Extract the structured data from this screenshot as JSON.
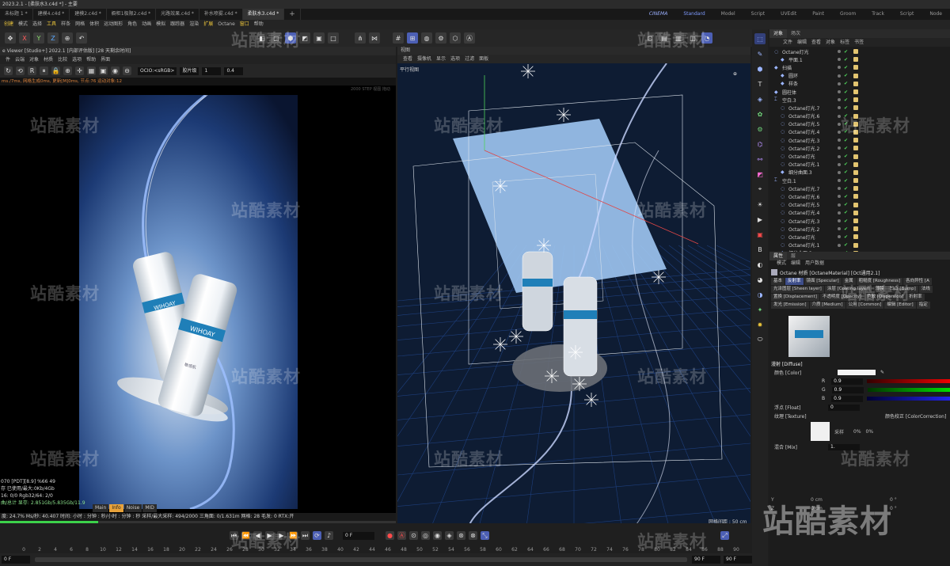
{
  "titlebar": {
    "text": "2023.2.1 - [柔肤水3.c4d *] - 主要"
  },
  "doc_tabs": [
    "未标题 1 *",
    "建模4.c4d *",
    "建模2.c4d *",
    "橱柜1极限2.c4d *",
    "光路效果.c4d *",
    "补水喷雾.c4d *",
    "柔肤水3.c4d *"
  ],
  "doc_tab_add": "+",
  "layout_tabs": [
    "Standard",
    "Model",
    "Script",
    "UVEdit",
    "Paint",
    "Groom",
    "Track",
    "Script",
    "Node"
  ],
  "layout_logo": "CINEMA",
  "menu": [
    "创建",
    "模式",
    "选择",
    "工具",
    "样条",
    "网格",
    "体积",
    "运动图形",
    "角色",
    "动画",
    "模拟",
    "跟踪器",
    "渲染",
    "扩展",
    "Octane",
    "窗口",
    "帮助"
  ],
  "toolbar": {
    "x": "X",
    "y": "Y",
    "z": "Z"
  },
  "viewer": {
    "title": "e Viewer [Studio+] 2022.1 [内部评估版] [28 天剩余时间]",
    "menu": [
      "件",
      "云端",
      "对象",
      "材质",
      "比较",
      "选项",
      "帮助",
      "界面"
    ],
    "ocio": "OCIO:<sRGB>",
    "look": "胶片级",
    "value1": "1",
    "value2": "0.4",
    "status": "ms./7ms, 网格生成0ms, 更新[M]0ms, 节点:76 运动对象:12",
    "hint": "2000 STEP 视图 拖动",
    "stats": [
      "070 [PDT][8.9]       %66     49",
      "存 已使用/最大:0Kb/4Gb",
      "16: 0/0         Rgb32/64: 2/0",
      "曲/总计 显存: 2.851Gb/5.835Gb/11.9"
    ],
    "tabs": [
      "Main",
      "Info",
      "Noise",
      "MID"
    ],
    "active_tab": "Info",
    "bottom": "度: 24.7%  Ms/秒: 40.407   时间: 小时 : 分钟 : 秒/小时 : 分钟 : 秒    采样/最大采样: 494/2000  三角面: 0/1.631m   网格: 28   毛发: 0   RTX:开",
    "progress": 0.247
  },
  "product": {
    "brand": "WIHOAY",
    "sub": "敏感肌"
  },
  "viewport": {
    "head": "视图",
    "menu": [
      "查看",
      "摄像机",
      "显示",
      "选项",
      "过滤",
      "面板"
    ],
    "label": "平行视图",
    "scale": "网格间距 : 50 cm"
  },
  "objects": {
    "tabs": [
      "对象",
      "场次"
    ],
    "menu": [
      "文件",
      "编辑",
      "查看",
      "对象",
      "标签",
      "书签"
    ],
    "rows": [
      {
        "name": "Octane灯光",
        "indent": 0,
        "icon": "light-icon"
      },
      {
        "name": "平面.1",
        "indent": 1,
        "icon": "plane-icon"
      },
      {
        "name": "扫描",
        "indent": 0,
        "icon": "sweep-icon"
      },
      {
        "name": "圆环",
        "indent": 1,
        "icon": "circle-icon"
      },
      {
        "name": "样条",
        "indent": 1,
        "icon": "spline-icon"
      },
      {
        "name": "圆柱体",
        "indent": 0,
        "icon": "cylinder-icon"
      },
      {
        "name": "空白.3",
        "indent": 0,
        "icon": "null-icon"
      },
      {
        "name": "Octane灯光.7",
        "indent": 1,
        "icon": "light-icon"
      },
      {
        "name": "Octane灯光.6",
        "indent": 1,
        "icon": "light-icon"
      },
      {
        "name": "Octane灯光.5",
        "indent": 1,
        "icon": "light-icon"
      },
      {
        "name": "Octane灯光.4",
        "indent": 1,
        "icon": "light-icon"
      },
      {
        "name": "Octane灯光.3",
        "indent": 1,
        "icon": "light-icon"
      },
      {
        "name": "Octane灯光.2",
        "indent": 1,
        "icon": "light-icon"
      },
      {
        "name": "Octane灯光",
        "indent": 1,
        "icon": "light-icon"
      },
      {
        "name": "Octane灯光.1",
        "indent": 1,
        "icon": "light-icon"
      },
      {
        "name": "细分曲面.3",
        "indent": 1,
        "icon": "subdiv-icon"
      },
      {
        "name": "空白.1",
        "indent": 0,
        "icon": "null-icon"
      },
      {
        "name": "Octane灯光.7",
        "indent": 1,
        "icon": "light-icon"
      },
      {
        "name": "Octane灯光.6",
        "indent": 1,
        "icon": "light-icon"
      },
      {
        "name": "Octane灯光.5",
        "indent": 1,
        "icon": "light-icon"
      },
      {
        "name": "Octane灯光.4",
        "indent": 1,
        "icon": "light-icon"
      },
      {
        "name": "Octane灯光.3",
        "indent": 1,
        "icon": "light-icon"
      },
      {
        "name": "Octane灯光.2",
        "indent": 1,
        "icon": "light-icon"
      },
      {
        "name": "Octane灯光",
        "indent": 1,
        "icon": "light-icon"
      },
      {
        "name": "Octane灯光.1",
        "indent": 1,
        "icon": "light-icon"
      },
      {
        "name": "细分曲面.3",
        "indent": 1,
        "icon": "subdiv-icon"
      }
    ]
  },
  "attributes": {
    "tabs": [
      "属性",
      "层"
    ],
    "menu": [
      "模式",
      "编辑",
      "用户数据"
    ],
    "title": "Octane 材质 [OctaneMaterial] [Oct通用2.1]",
    "chips": [
      "基本",
      "反射率",
      "镜面 [Specular]",
      "金属",
      "粗糙度 [Roughness]",
      "各向异性 [A",
      "光泽图层 [Sheen layer]",
      "涂层 [Coating layer]",
      "薄膜",
      "凹凸 [Bump]",
      "法线",
      "置换 [Displacement]",
      "不透明度 [Opacity]",
      "色散 [Dispersion]",
      "折射率",
      "发光 [Emission]",
      "介质 [Medium]",
      "公用 [Common]",
      "编辑 [Editor]",
      "指定"
    ],
    "active_chip": "反射率",
    "diffuse_label": "漫射 [Diffuse]",
    "color_label": "颜色 [Color]",
    "r_label": "R",
    "g_label": "G",
    "b_label": "B",
    "r": "0.9",
    "g": "0.9",
    "b": "0.9",
    "float_label": "浮点 [Float]",
    "float_val": "0",
    "texture_label": "纹理 [Texture]",
    "texture_name": "采样",
    "texture_opt": "颜色校正 [ColorCorrection]",
    "tex_pct1": "0%",
    "tex_pct2": "0%",
    "mix_label": "混合 [Mix]",
    "mix_val": "1."
  },
  "coords": {
    "y_label": "Y",
    "z_label": "Z",
    "y_val": "0 cm",
    "z_val": "0 cm",
    "y_rot": "0 °",
    "z_rot": "0 °"
  },
  "timeline": {
    "frame_field": "0 F",
    "ruler": [
      "0",
      "2",
      "4",
      "6",
      "8",
      "10",
      "12",
      "14",
      "16",
      "18",
      "20",
      "22",
      "24",
      "26",
      "28",
      "30",
      "32",
      "34",
      "36",
      "38",
      "40",
      "42",
      "44",
      "46",
      "48",
      "50",
      "52",
      "54",
      "56",
      "58",
      "60",
      "62",
      "64",
      "66",
      "68",
      "70",
      "72",
      "74",
      "76",
      "78",
      "80",
      "82",
      "84",
      "86",
      "88",
      "90"
    ],
    "start": "0 F",
    "end1": "90 F",
    "end2": "90 F"
  },
  "watermark": "站酷素材",
  "colors": {
    "accent": "#4c5fb4",
    "render_bg_top": "#0a1530",
    "render_bg_mid": "#5f8cc9",
    "viewport_bg": "#0e1c33",
    "progress": "#3cd14a",
    "check": "#4fd35a"
  }
}
